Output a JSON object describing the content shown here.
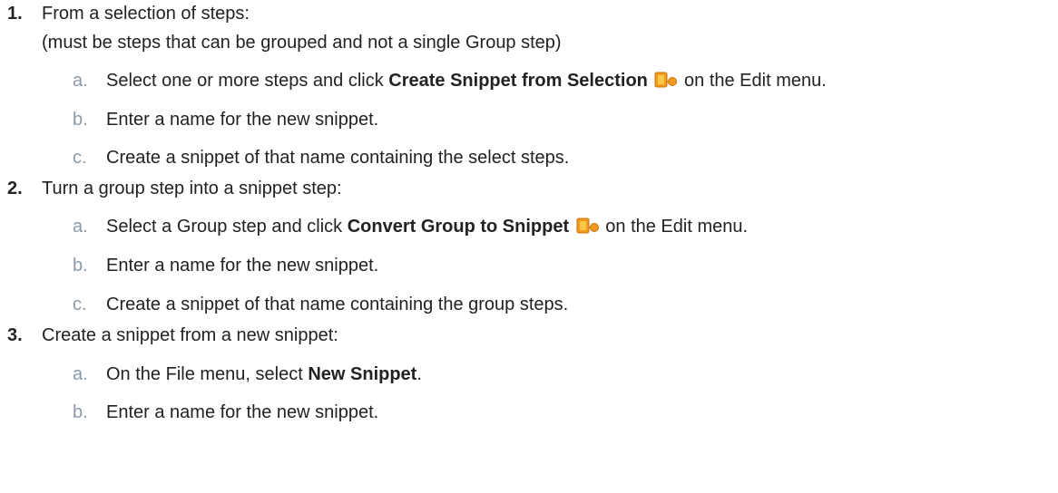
{
  "steps": [
    {
      "number": "1.",
      "text": "From a selection of steps:",
      "note": "(must be steps that can be grouped and not a single Group step)",
      "substeps": [
        {
          "letter": "a.",
          "pre": "Select one or more steps and click ",
          "bold": "Create Snippet from Selection",
          "icon": "snippet-icon",
          "post": " on the Edit menu."
        },
        {
          "letter": "b.",
          "text": "Enter a name for the new snippet."
        },
        {
          "letter": "c.",
          "text": "Create a snippet of that name containing the select steps."
        }
      ]
    },
    {
      "number": "2.",
      "text": "Turn a group step into a snippet step:",
      "substeps": [
        {
          "letter": "a.",
          "pre": "Select a Group step and click ",
          "bold": "Convert Group to Snippet",
          "icon": "snippet-icon",
          "post": " on the Edit menu."
        },
        {
          "letter": "b.",
          "text": "Enter a name for the new snippet."
        },
        {
          "letter": "c.",
          "text": "Create a snippet of that name containing the group steps."
        }
      ]
    },
    {
      "number": "3.",
      "text": "Create a snippet from a new snippet:",
      "substeps": [
        {
          "letter": "a.",
          "pre": "On the File menu, select ",
          "bold": "New Snippet",
          "post": "."
        },
        {
          "letter": "b.",
          "text": "Enter a name for the new snippet."
        }
      ]
    }
  ],
  "colors": {
    "text": "#222222",
    "sub_letter": "#8a9aa8",
    "icon_orange": "#f39a1e",
    "icon_yellow": "#f7c948",
    "background": "#ffffff"
  }
}
